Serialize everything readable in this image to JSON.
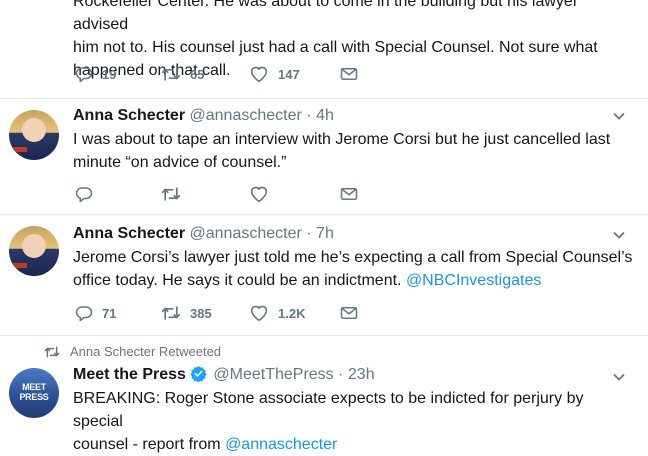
{
  "tweet0": {
    "text_line1": "Rockefeller Center. He was about to come in the building but his lawyer advised",
    "text_line2": "him not to. His counsel just had a call with Special Counsel. Not sure what",
    "text_line3": "happened on that call.",
    "replies": "19",
    "retweets": "65",
    "likes": "147"
  },
  "tweet1": {
    "name": "Anna Schecter",
    "handle": "@annaschecter",
    "dot": "·",
    "time": "4h",
    "text_line1": "I was about to tape an interview with Jerome Corsi but he just cancelled last",
    "text_line2": "minute “on advice of counsel.”",
    "replies": "",
    "retweets": "",
    "likes": ""
  },
  "tweet2": {
    "name": "Anna Schecter",
    "handle": "@annaschecter",
    "dot": "·",
    "time": "7h",
    "text_line1": "Jerome Corsi’s lawyer just told me he’s expecting a call from Special Counsel’s",
    "text_line2": "office today. He says it could be an indictment.",
    "mention": "@NBCInvestigates",
    "replies": "71",
    "retweets": "385",
    "likes": "1.2K"
  },
  "retweet_banner": "Anna Schecter Retweeted",
  "tweet3": {
    "name": "Meet the Press",
    "handle": "@MeetThePress",
    "dot": "·",
    "time": "23h",
    "text_line1": "BREAKING: Roger Stone associate expects to be indicted for perjury by special",
    "text_line2": "counsel - report from",
    "mention": "@annaschecter",
    "avatar_text": "MEET PRESS"
  },
  "colors": {
    "link": "#1b95e0",
    "meta": "#657786",
    "text": "#14171a",
    "border": "#e6ecf0"
  },
  "icons": [
    "reply-icon",
    "retweet-icon",
    "like-icon",
    "direct-message-icon",
    "caret-down-icon",
    "verified-badge-icon"
  ]
}
